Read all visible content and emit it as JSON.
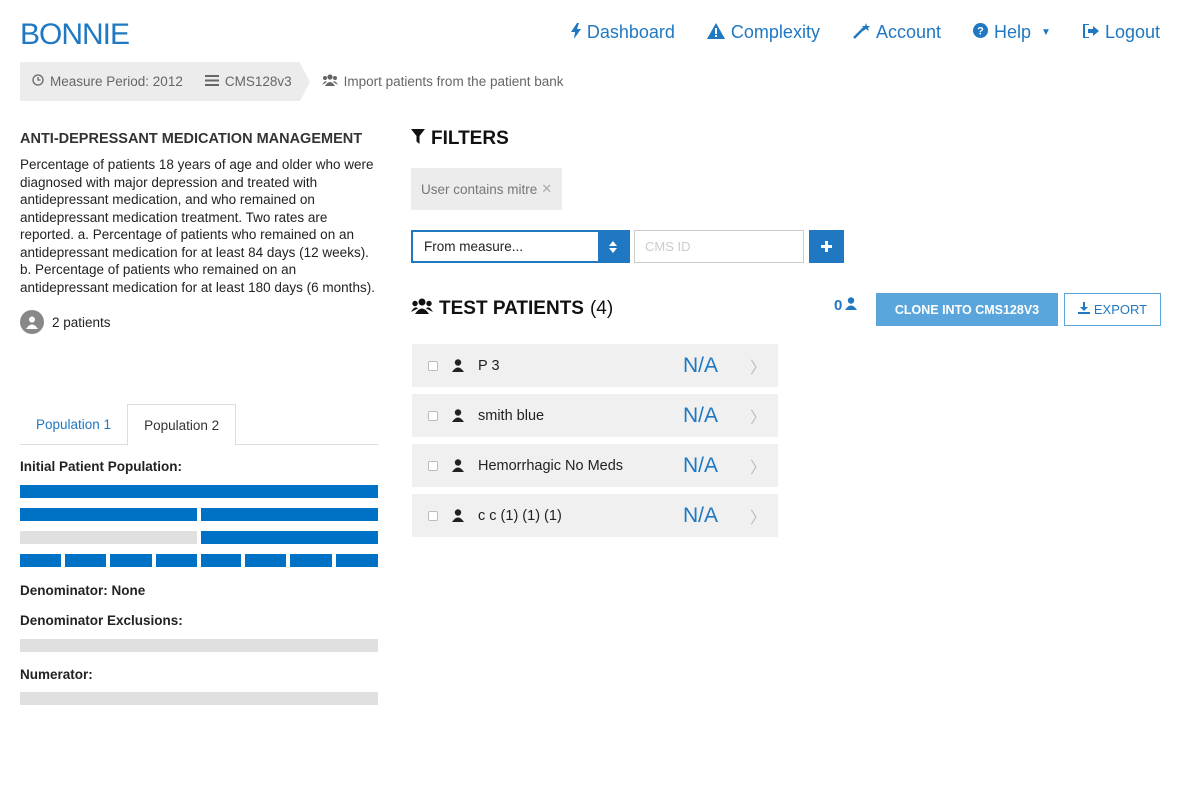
{
  "header": {
    "logo": "BONNIE",
    "nav": [
      {
        "label": "Dashboard",
        "icon": "bolt-icon"
      },
      {
        "label": "Complexity",
        "icon": "warning-icon"
      },
      {
        "label": "Account",
        "icon": "magic-wand-icon"
      },
      {
        "label": "Help",
        "icon": "question-circle-icon"
      },
      {
        "label": "Logout",
        "icon": "sign-out-icon"
      }
    ]
  },
  "breadcrumb": {
    "period": "Measure Period: 2012",
    "measure": "CMS128v3",
    "action": "Import patients from the patient bank"
  },
  "measure": {
    "title": "ANTI-DEPRESSANT MEDICATION MANAGEMENT",
    "description": "Percentage of patients 18 years of age and older who were diagnosed with major depression and treated with antidepressant medication, and who remained on antidepressant medication treatment. Two rates are reported. a. Percentage of patients who remained on an antidepressant medication for at least 84 days (12 weeks). b. Percentage of patients who remained on an antidepressant medication for at least 180 days (6 months).",
    "patients": "2 patients"
  },
  "tabs": [
    {
      "label": "Population 1",
      "active": false
    },
    {
      "label": "Population 2",
      "active": true
    }
  ],
  "population": {
    "ipp_label": "Initial Patient Population:",
    "denominator_label": "Denominator: None",
    "denex_label": "Denominator Exclusions:",
    "numerator_label": "Numerator:"
  },
  "filters": {
    "title": "FILTERS",
    "active_filter": "User contains mitre",
    "select_value": "From measure...",
    "cms_placeholder": "CMS ID"
  },
  "test_patients": {
    "title": "TEST PATIENTS",
    "count": "(4)",
    "selected_count": "0",
    "clone_label": "CLONE INTO CMS128V3",
    "export_label": "EXPORT",
    "rows": [
      {
        "name": "P 3",
        "status": "N/A"
      },
      {
        "name": "smith blue",
        "status": "N/A"
      },
      {
        "name": "Hemorrhagic No Meds",
        "status": "N/A"
      },
      {
        "name": "c c (1) (1) (1)",
        "status": "N/A"
      }
    ]
  },
  "colors": {
    "primary": "#1f78c1",
    "bar_blue": "#0072c6",
    "bar_grey": "#e0e0e0",
    "light_button": "#5aa6dc"
  }
}
